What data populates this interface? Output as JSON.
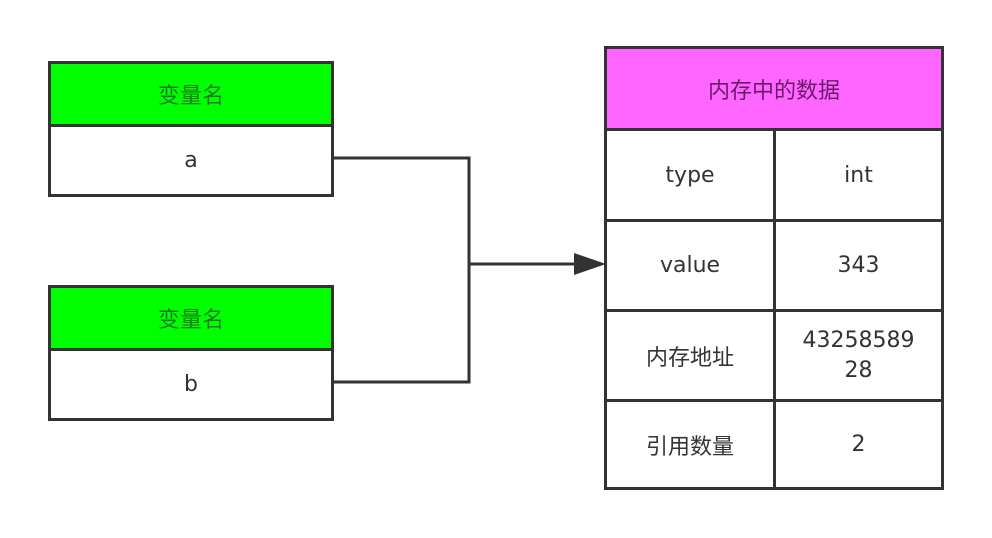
{
  "variables": [
    {
      "header": "变量名",
      "name": "a"
    },
    {
      "header": "变量名",
      "name": "b"
    }
  ],
  "memory": {
    "title": "内存中的数据",
    "rows": [
      {
        "label": "type",
        "value": "int"
      },
      {
        "label": "value",
        "value": "343"
      },
      {
        "label": "内存地址",
        "value": "4325858928",
        "value_line1": "43258589",
        "value_line2": "28"
      },
      {
        "label": "引用数量",
        "value": "2"
      }
    ]
  },
  "colors": {
    "variable_header": "#00ff00",
    "memory_header": "#ff66ff",
    "border": "#333333"
  }
}
